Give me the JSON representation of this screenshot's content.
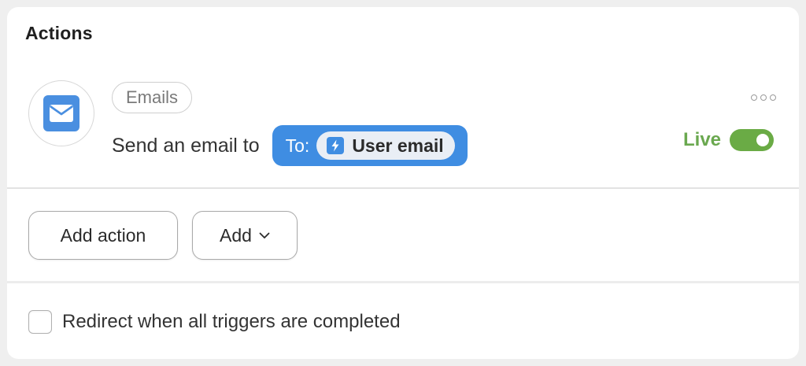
{
  "section": {
    "title": "Actions"
  },
  "action": {
    "app_icon": "envelope-icon",
    "category_tag": "Emails",
    "sentence": "Send an email to",
    "recipient_label": "To:",
    "recipient_token_icon": "lightning-icon",
    "recipient_token": "User email",
    "more_icon": "more-options-icon",
    "status_label": "Live",
    "status_on": true
  },
  "buttons": {
    "add_action": "Add action",
    "add": "Add"
  },
  "options": {
    "redirect_label": "Redirect when all triggers are completed",
    "redirect_checked": false
  },
  "colors": {
    "accent_blue": "#3f8de2",
    "live_green": "#6aa84f",
    "toggle_green": "#6aab45"
  }
}
